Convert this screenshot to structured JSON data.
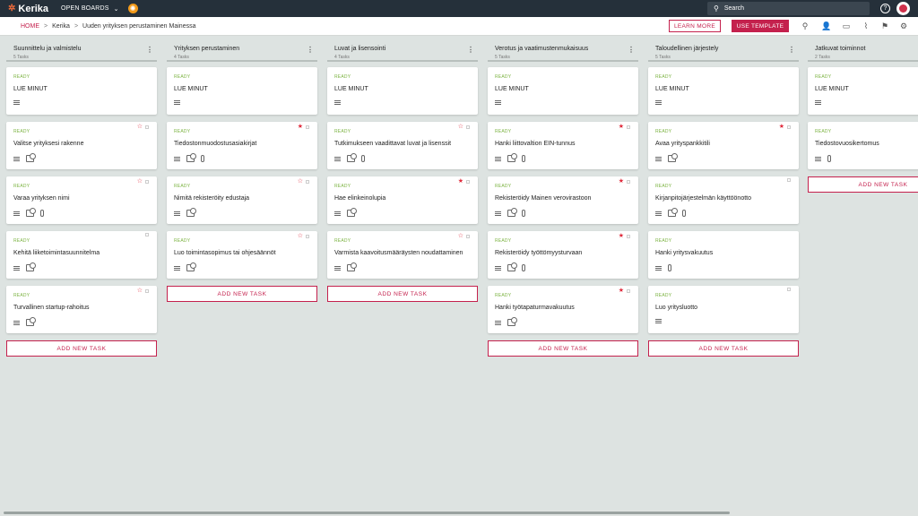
{
  "topbar": {
    "logo_text": "Kerika",
    "boards_label": "OPEN BOARDS",
    "search_placeholder": "Search",
    "help_icon": "question-icon",
    "brand_color": "#c4214d"
  },
  "breadcrumb": {
    "home": "HOME",
    "items": [
      "Kerika",
      "Uuden yrityksen perustaminen Mainessa"
    ]
  },
  "actions": {
    "learn_more": "LEARN MORE",
    "use_template": "USE TEMPLATE"
  },
  "toolbar_icons": [
    "search-icon",
    "add-person-icon",
    "chat-icon",
    "attachment-icon",
    "pin-icon",
    "settings-icon"
  ],
  "add_task_label": "ADD NEW TASK",
  "columns": [
    {
      "title": "Suunnittelu ja valmistelu",
      "count": "5 Tasks",
      "cards": [
        {
          "status": "READY",
          "title": "LUE MINUT",
          "star": "none",
          "icons": [
            "lines"
          ]
        },
        {
          "status": "READY",
          "title": "Valitse yrityksesi rakenne",
          "star": "outline",
          "icons": [
            "lines",
            "checklist"
          ]
        },
        {
          "status": "READY",
          "title": "Varaa yrityksen nimi",
          "star": "outline",
          "icons": [
            "lines",
            "checklist",
            "clip"
          ]
        },
        {
          "status": "READY",
          "title": "Kehitä liiketoimintasuunnitelma",
          "star": "box",
          "icons": [
            "lines",
            "checklist"
          ]
        },
        {
          "status": "READY",
          "title": "Turvallinen startup-rahoitus",
          "star": "outline",
          "icons": [
            "lines",
            "checklist"
          ]
        }
      ]
    },
    {
      "title": "Yrityksen perustaminen",
      "count": "4 Tasks",
      "cards": [
        {
          "status": "READY",
          "title": "LUE MINUT",
          "star": "none",
          "icons": [
            "lines"
          ]
        },
        {
          "status": "READY",
          "title": "Tiedostonmuodostusasiakirjat",
          "star": "filled",
          "icons": [
            "lines",
            "checklist",
            "clip"
          ]
        },
        {
          "status": "READY",
          "title": "Nimitä rekisteröity edustaja",
          "star": "outline",
          "icons": [
            "lines",
            "checklist"
          ]
        },
        {
          "status": "READY",
          "title": "Luo toimintasopimus tai ohjesäännöt",
          "star": "outline",
          "icons": [
            "lines",
            "checklist"
          ]
        }
      ]
    },
    {
      "title": "Luvat ja lisensointi",
      "count": "4 Tasks",
      "cards": [
        {
          "status": "READY",
          "title": "LUE MINUT",
          "star": "none",
          "icons": [
            "lines"
          ]
        },
        {
          "status": "READY",
          "title": "Tutkimukseen vaadittavat luvat ja lisenssit",
          "star": "outline",
          "icons": [
            "lines",
            "checklist",
            "clip"
          ]
        },
        {
          "status": "READY",
          "title": "Hae elinkeinolupia",
          "star": "filled",
          "icons": [
            "lines",
            "checklist"
          ]
        },
        {
          "status": "READY",
          "title": "Varmista kaavoitusmääräysten noudattaminen",
          "star": "outline",
          "icons": [
            "lines",
            "checklist"
          ]
        }
      ]
    },
    {
      "title": "Verotus ja vaatimustenmukaisuus",
      "count": "5 Tasks",
      "cards": [
        {
          "status": "READY",
          "title": "LUE MINUT",
          "star": "none",
          "icons": [
            "lines"
          ]
        },
        {
          "status": "READY",
          "title": "Hanki liittovaltion EIN-tunnus",
          "star": "filled",
          "icons": [
            "lines",
            "checklist",
            "clip"
          ]
        },
        {
          "status": "READY",
          "title": "Rekisteröidy Mainen verovirastoon",
          "star": "filled",
          "icons": [
            "lines",
            "checklist",
            "clip"
          ]
        },
        {
          "status": "READY",
          "title": "Rekisteröidy työttömyysturvaan",
          "star": "filled",
          "icons": [
            "lines",
            "checklist",
            "clip"
          ]
        },
        {
          "status": "READY",
          "title": "Hanki työtapaturmavakuutus",
          "star": "filled",
          "icons": [
            "lines",
            "checklist"
          ]
        }
      ]
    },
    {
      "title": "Taloudellinen järjestely",
      "count": "5 Tasks",
      "cards": [
        {
          "status": "READY",
          "title": "LUE MINUT",
          "star": "none",
          "icons": [
            "lines"
          ]
        },
        {
          "status": "READY",
          "title": "Avaa yrityspankkitili",
          "star": "filled",
          "icons": [
            "lines",
            "checklist"
          ]
        },
        {
          "status": "READY",
          "title": "Kirjanpitojärjestelmän käyttöönotto",
          "star": "box",
          "icons": [
            "lines",
            "checklist",
            "clip"
          ]
        },
        {
          "status": "READY",
          "title": "Hanki yritysvakuutus",
          "star": "none",
          "icons": [
            "lines",
            "clip"
          ]
        },
        {
          "status": "READY",
          "title": "Luo yritysluotto",
          "star": "box",
          "icons": [
            "lines"
          ]
        }
      ]
    },
    {
      "title": "Jatkuvat toiminnot",
      "count": "2 Tasks",
      "cards": [
        {
          "status": "READY",
          "title": "LUE MINUT",
          "star": "none",
          "icons": [
            "lines"
          ]
        },
        {
          "status": "READY",
          "title": "Tiedostovuosikertomus",
          "star": "none",
          "icons": [
            "lines",
            "clip"
          ]
        }
      ]
    }
  ]
}
